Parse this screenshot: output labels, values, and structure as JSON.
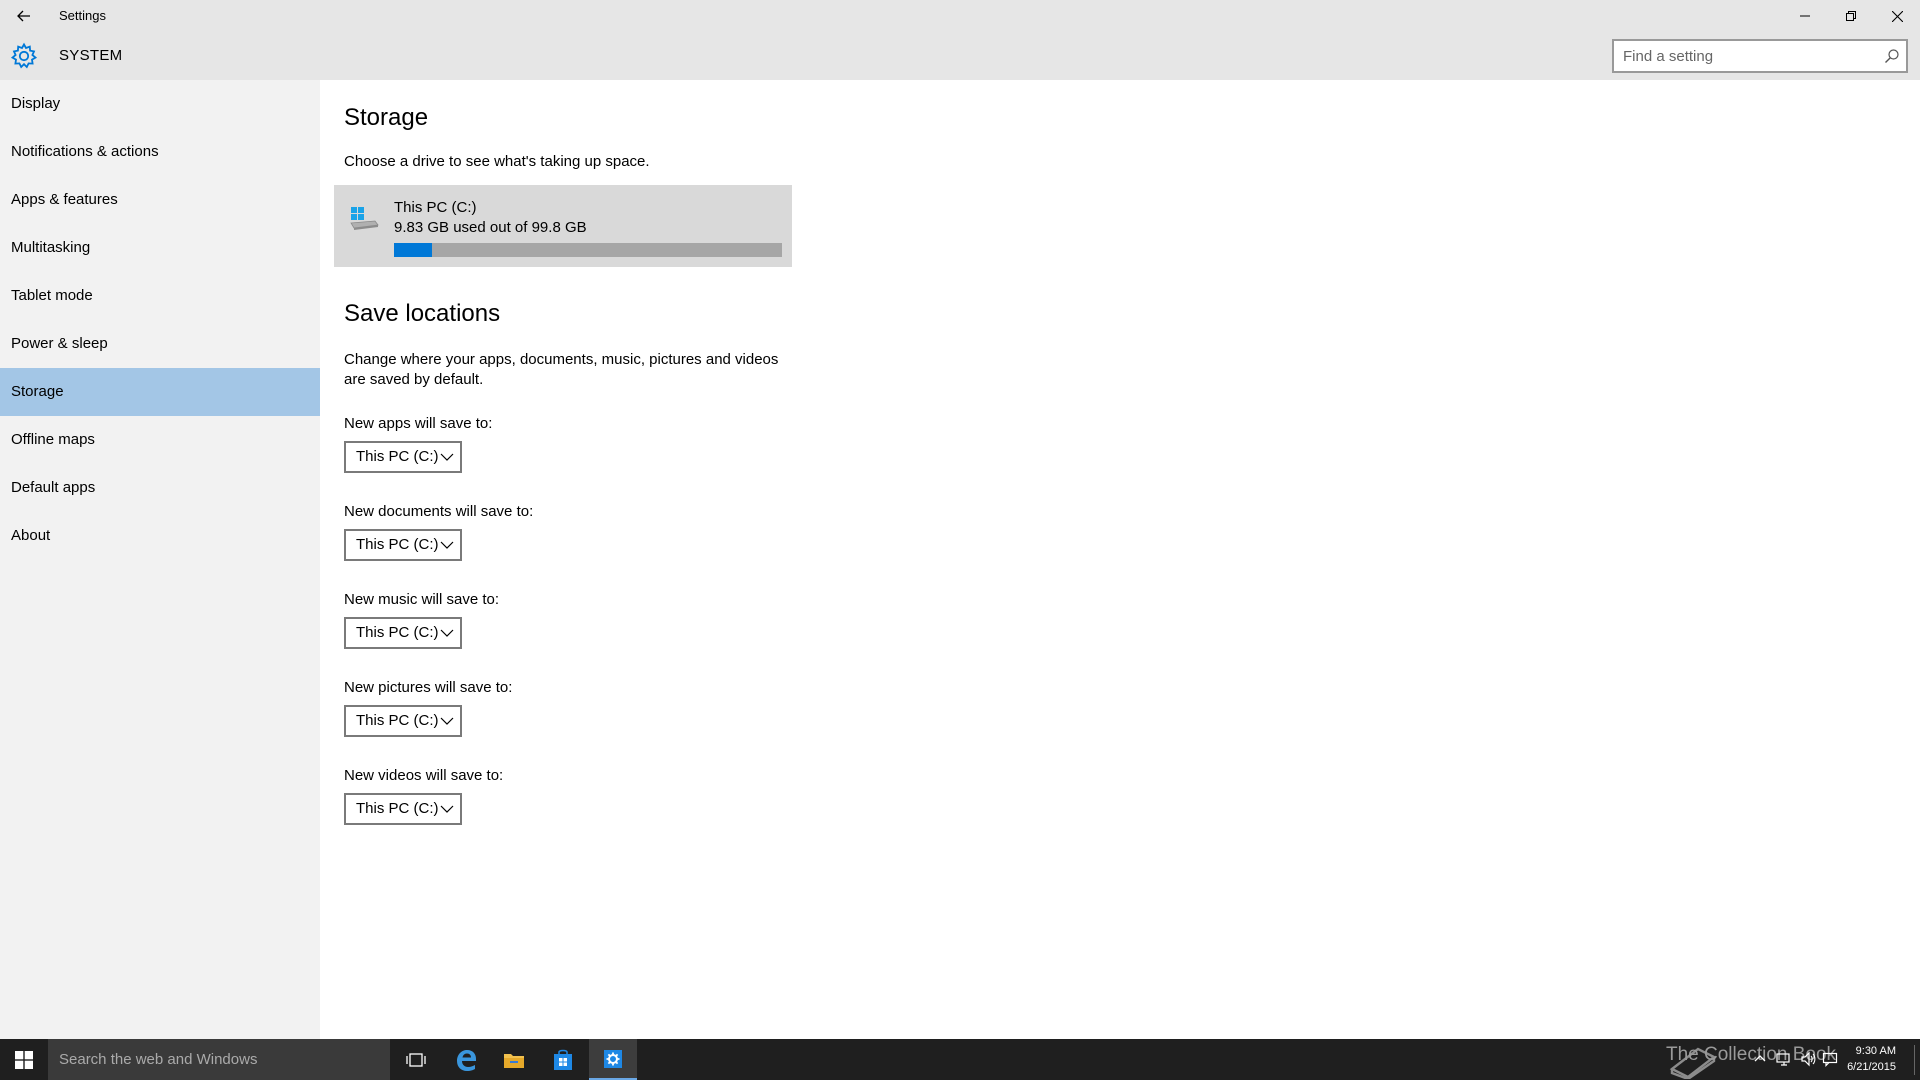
{
  "window": {
    "title": "Settings",
    "controls": {
      "minimize": "minimize",
      "restore": "restore",
      "close": "close"
    }
  },
  "header": {
    "title": "SYSTEM",
    "search_placeholder": "Find a setting"
  },
  "sidebar": {
    "items": [
      {
        "label": "Display"
      },
      {
        "label": "Notifications & actions"
      },
      {
        "label": "Apps & features"
      },
      {
        "label": "Multitasking"
      },
      {
        "label": "Tablet mode"
      },
      {
        "label": "Power & sleep"
      },
      {
        "label": "Storage",
        "selected": true
      },
      {
        "label": "Offline maps"
      },
      {
        "label": "Default apps"
      },
      {
        "label": "About"
      }
    ]
  },
  "main": {
    "storage_title": "Storage",
    "storage_desc": "Choose a drive to see what's taking up space.",
    "drive": {
      "name": "This PC (C:)",
      "usage": "9.83 GB used out of 99.8 GB",
      "used_fraction": 0.0985
    },
    "save_title": "Save locations",
    "save_desc_line1": "Change where your apps, documents, music, pictures and videos",
    "save_desc_line2": "are saved by default.",
    "save_fields": [
      {
        "label": "New apps will save to:",
        "value": "This PC (C:)"
      },
      {
        "label": "New documents will save to:",
        "value": "This PC (C:)"
      },
      {
        "label": "New music will save to:",
        "value": "This PC (C:)"
      },
      {
        "label": "New pictures will save to:",
        "value": "This PC (C:)"
      },
      {
        "label": "New videos will save to:",
        "value": "This PC (C:)"
      }
    ]
  },
  "taskbar": {
    "search_placeholder": "Search the web and Windows",
    "watermark": "The Collection Book",
    "time": "9:30 AM",
    "date": "6/21/2015"
  },
  "colors": {
    "accent": "#0078d7",
    "selected_nav": "#a3c6e6",
    "sidebar_bg": "#f2f2f2",
    "titlebar_bg": "#e6e6e6",
    "taskbar_bg": "#1f1f1f"
  }
}
